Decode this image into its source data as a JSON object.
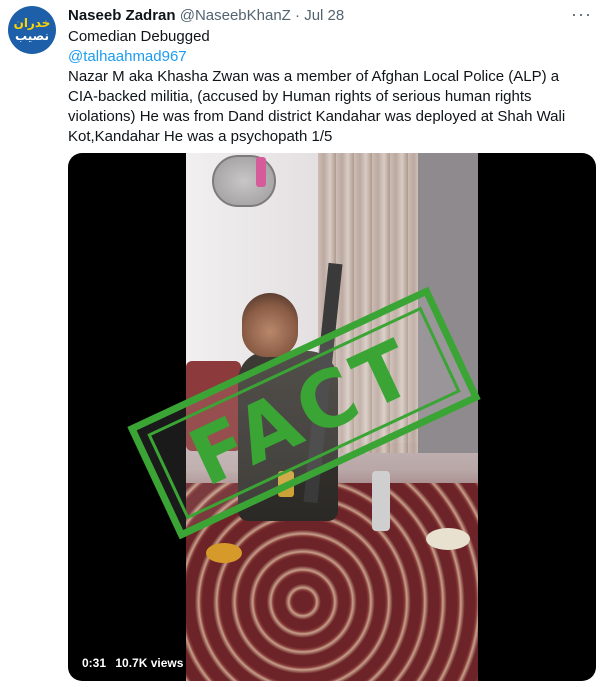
{
  "tweet": {
    "author_name": "Naseeb Zadran",
    "handle": "@NaseebKhanZ",
    "separator": "·",
    "date": "Jul 28",
    "more": "···",
    "subtitle": "Comedian Debugged",
    "mention": "@talhaahmad967",
    "body": "Nazar M aka Khasha Zwan was a member of Afghan Local Police (ALP) a CIA-backed militia, (accused by Human rights of serious human rights violations) He was from Dand district Kandahar was deployed at Shah Wali Kot,Kandahar He was a psychopath 1/5"
  },
  "avatar": {
    "line1": "خدران",
    "line2": "نصیب"
  },
  "media": {
    "stamp_text": "FACT",
    "duration": "0:31",
    "views": "10.7K views"
  },
  "colors": {
    "stamp": "#3aa534",
    "link": "#1d9bf0",
    "muted": "#536471"
  }
}
